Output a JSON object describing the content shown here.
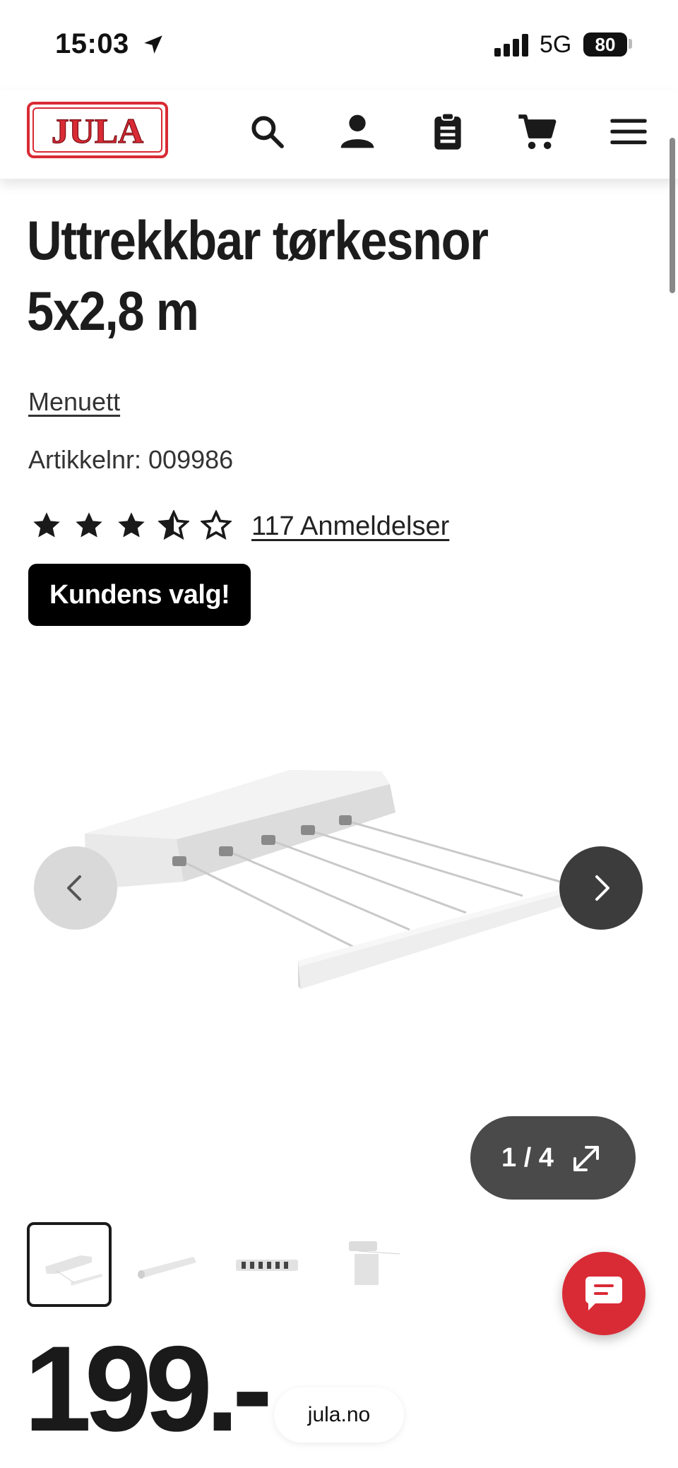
{
  "status_bar": {
    "time": "15:03",
    "network": "5G",
    "battery": "80"
  },
  "header": {
    "logo_text": "JULA",
    "icons": [
      "search-icon",
      "user-icon",
      "clipboard-icon",
      "cart-icon",
      "menu-icon"
    ]
  },
  "product": {
    "title": "Uttrekkbar tørkesnor 5x2,8 m",
    "brand": "Menuett",
    "article_label": "Artikkelnr:",
    "article_number": "009986",
    "rating": 3.5,
    "rating_max": 5,
    "reviews_label": "117 Anmeldelser",
    "badge": "Kundens valg!"
  },
  "gallery": {
    "counter": "1 / 4",
    "current": 1,
    "total": 4
  },
  "price": {
    "value": "199.-"
  },
  "browser": {
    "url": "jula.no"
  },
  "colors": {
    "brand_red": "#d92b35",
    "text_dark": "#1c1c1c",
    "badge_bg": "#000000"
  }
}
